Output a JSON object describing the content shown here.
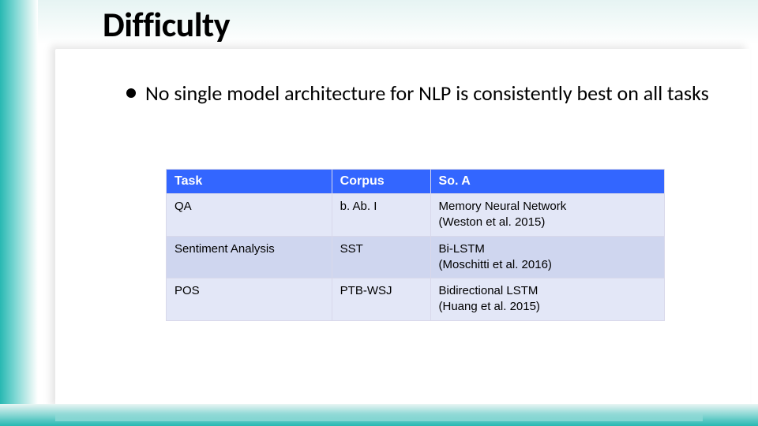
{
  "title": "Difficulty",
  "bullet": "No single model architecture for NLP is consistently best on all tasks",
  "table": {
    "headers": [
      "Task",
      "Corpus",
      "So. A"
    ],
    "rows": [
      {
        "task": "QA",
        "corpus": "b. Ab. I",
        "soa": "Memory Neural Network\n(Weston et al. 2015)"
      },
      {
        "task": "Sentiment Analysis",
        "corpus": "SST",
        "soa": "Bi-LSTM\n(Moschitti et al. 2016)"
      },
      {
        "task": "POS",
        "corpus": "PTB-WSJ",
        "soa": "Bidirectional LSTM\n(Huang et al. 2015)"
      }
    ]
  }
}
